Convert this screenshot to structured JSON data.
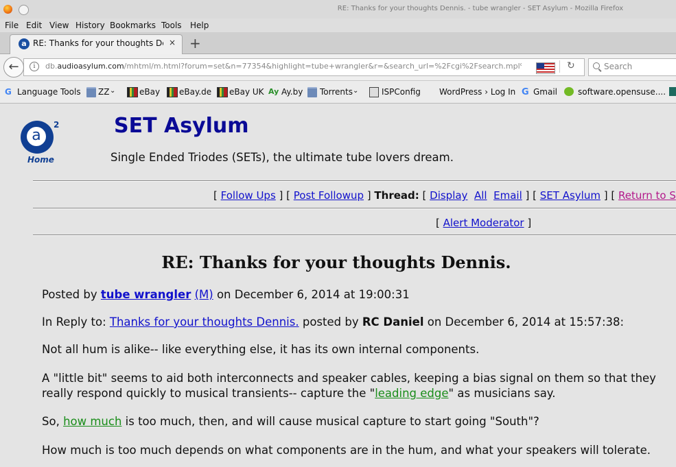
{
  "window": {
    "title": "RE: Thanks for your thoughts Dennis. - tube wrangler - SET Asylum - Mozilla Firefox"
  },
  "menu": [
    "File",
    "Edit",
    "View",
    "History",
    "Bookmarks",
    "Tools",
    "Help"
  ],
  "tab": {
    "title": "RE: Thanks for your thoughts De…",
    "close": "×",
    "new_tab": "+"
  },
  "nav": {
    "url_prefix": "db.",
    "url_domain": "audioasylum.com",
    "url_rest": "/mhtml/m.html?forum=set&n=77354&highlight=tube+wrangler&r=&search_url=%2Fcgi%2Fsearch.mpl%3",
    "search_placeholder": "Search"
  },
  "bookmarks": [
    "Language Tools",
    "ZZ",
    "eBay",
    "eBay.de",
    "eBay UK",
    "Ay.by",
    "Torrents",
    "ISPConfig",
    "WordPress › Log In",
    "Gmail",
    "software.opensuse...."
  ],
  "site": {
    "logo_letter": "a",
    "logo_sup": "2",
    "logo_home": "Home",
    "title": "SET Asylum",
    "subtitle": "Single Ended Triodes (SETs), the ultimate tube lovers dream."
  },
  "navlinks": {
    "follow_ups": "Follow Ups",
    "post_followup": "Post Followup",
    "thread_label": "Thread:",
    "display": "Display",
    "all": "All",
    "email": "Email",
    "forum": "SET Asylum",
    "return_to": "Return to S",
    "alert": "Alert Moderator"
  },
  "post": {
    "title": "RE: Thanks for your thoughts Dennis.",
    "posted_by_prefix": "Posted by",
    "author": "tube wrangler",
    "author_tag": "(M)",
    "posted_on": "on December 6, 2014 at 19:00:31",
    "reply_prefix": "In Reply to:",
    "reply_link": "Thanks for your thoughts Dennis.",
    "reply_posted_by": "posted by",
    "reply_author": "RC Daniel",
    "reply_date": "on December 6, 2014 at 15:57:38:",
    "p1": "Not all hum is alike-- like everything else, it has its own internal components.",
    "p2a": "A \"little bit\" seems to aid both interconnects and speaker cables, keeping a bias signal on them so that they really respond quickly to musical transients-- capture the \"",
    "p2_link": "leading edge",
    "p2b": "\" as musicians say.",
    "p3a": "So, ",
    "p3_link": "how much",
    "p3b": " is too much, then, and will cause musical capture to start going \"South\"?",
    "p4": "How much is too much depends on what components are in the hum, and what your speakers will tolerate."
  }
}
